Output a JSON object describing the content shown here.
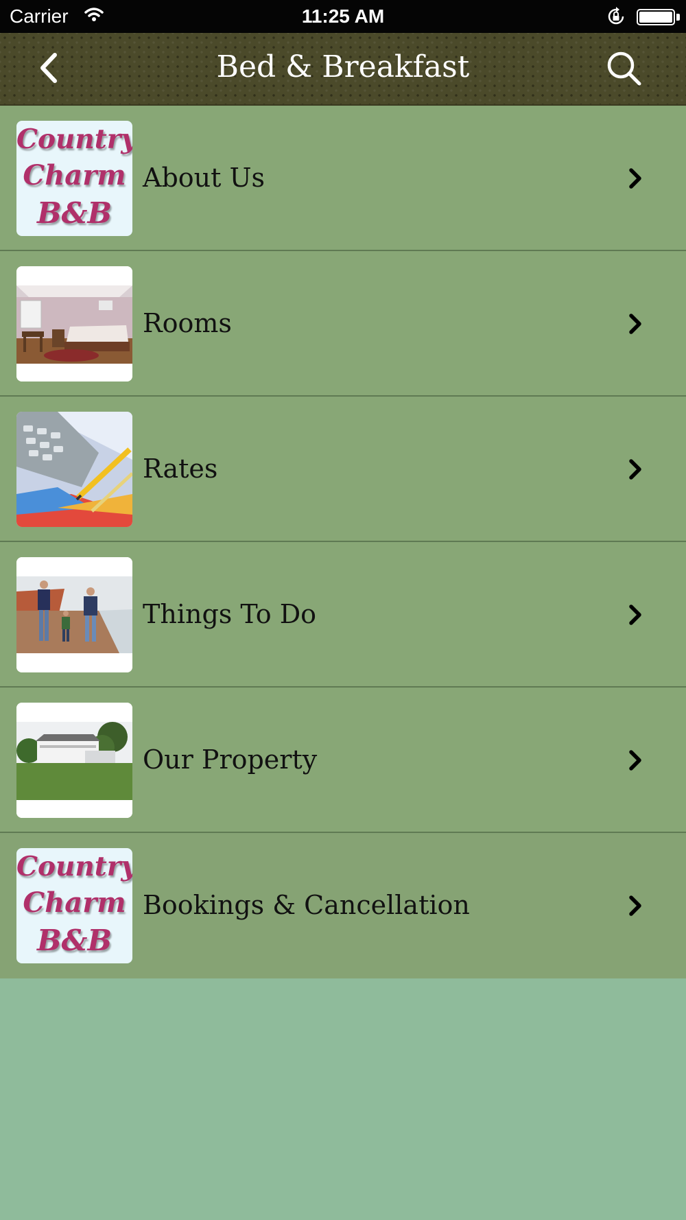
{
  "status_bar": {
    "carrier": "Carrier",
    "time": "11:25 AM"
  },
  "nav": {
    "title": "Bed & Breakfast",
    "back_icon": "chevron-left-icon",
    "search_icon": "search-icon"
  },
  "logo": {
    "line1": "Country",
    "line2": "Charm",
    "line3": "B&B"
  },
  "menu": [
    {
      "label": "About Us",
      "thumb": "logo"
    },
    {
      "label": "Rooms",
      "thumb": "bedroom-photo"
    },
    {
      "label": "Rates",
      "thumb": "calculator-photo"
    },
    {
      "label": "Things To Do",
      "thumb": "beach-family-photo"
    },
    {
      "label": "Our Property",
      "thumb": "house-photo"
    },
    {
      "label": "Bookings & Cancellation",
      "thumb": "logo"
    }
  ],
  "colors": {
    "nav_bg": "#4b4a2a",
    "row_bg": "#88a776",
    "page_bg": "#8fbb9b",
    "logo_text": "#b0306a"
  }
}
